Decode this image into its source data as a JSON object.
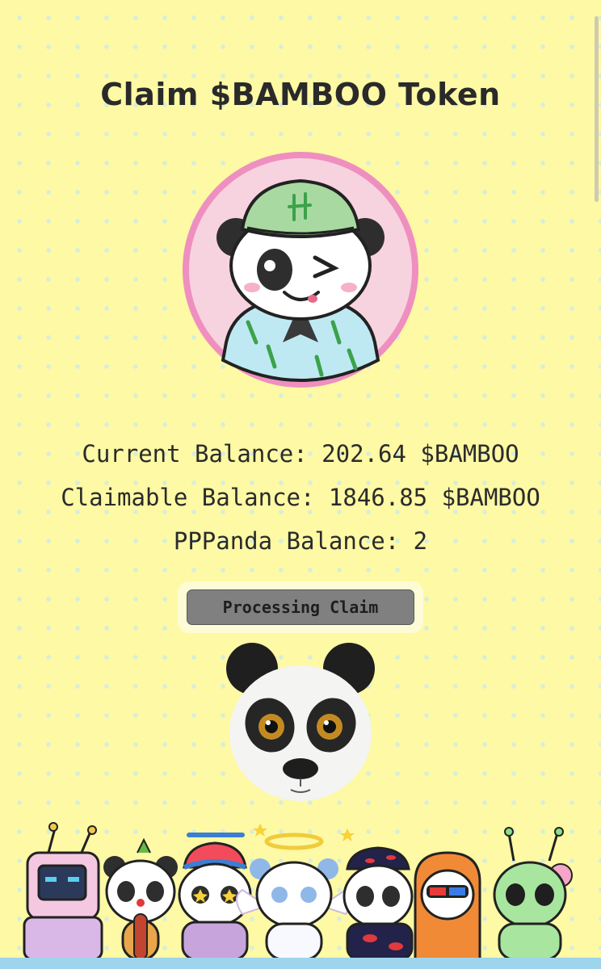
{
  "page": {
    "title": "Claim $BAMBOO Token"
  },
  "balances": {
    "current": "Current Balance: 202.64 $BAMBOO",
    "claimable": "Claimable Balance: 1846.85 $BAMBOO",
    "pppanda": "PPPanda Balance: 2"
  },
  "claim": {
    "label": "Processing Claim"
  },
  "images": {
    "avatar": "winking panda nft avatar with green bucket hat and bamboo shirt",
    "panda_head": "3d panda head",
    "crew": "row of cartoon panda characters"
  },
  "colors": {
    "background": "#fef9a4",
    "dots": "#d6eedb",
    "avatar_border": "#ee8fc0",
    "avatar_bg": "#f7d3df",
    "button": "#808080",
    "footer": "#9ed4ec"
  }
}
